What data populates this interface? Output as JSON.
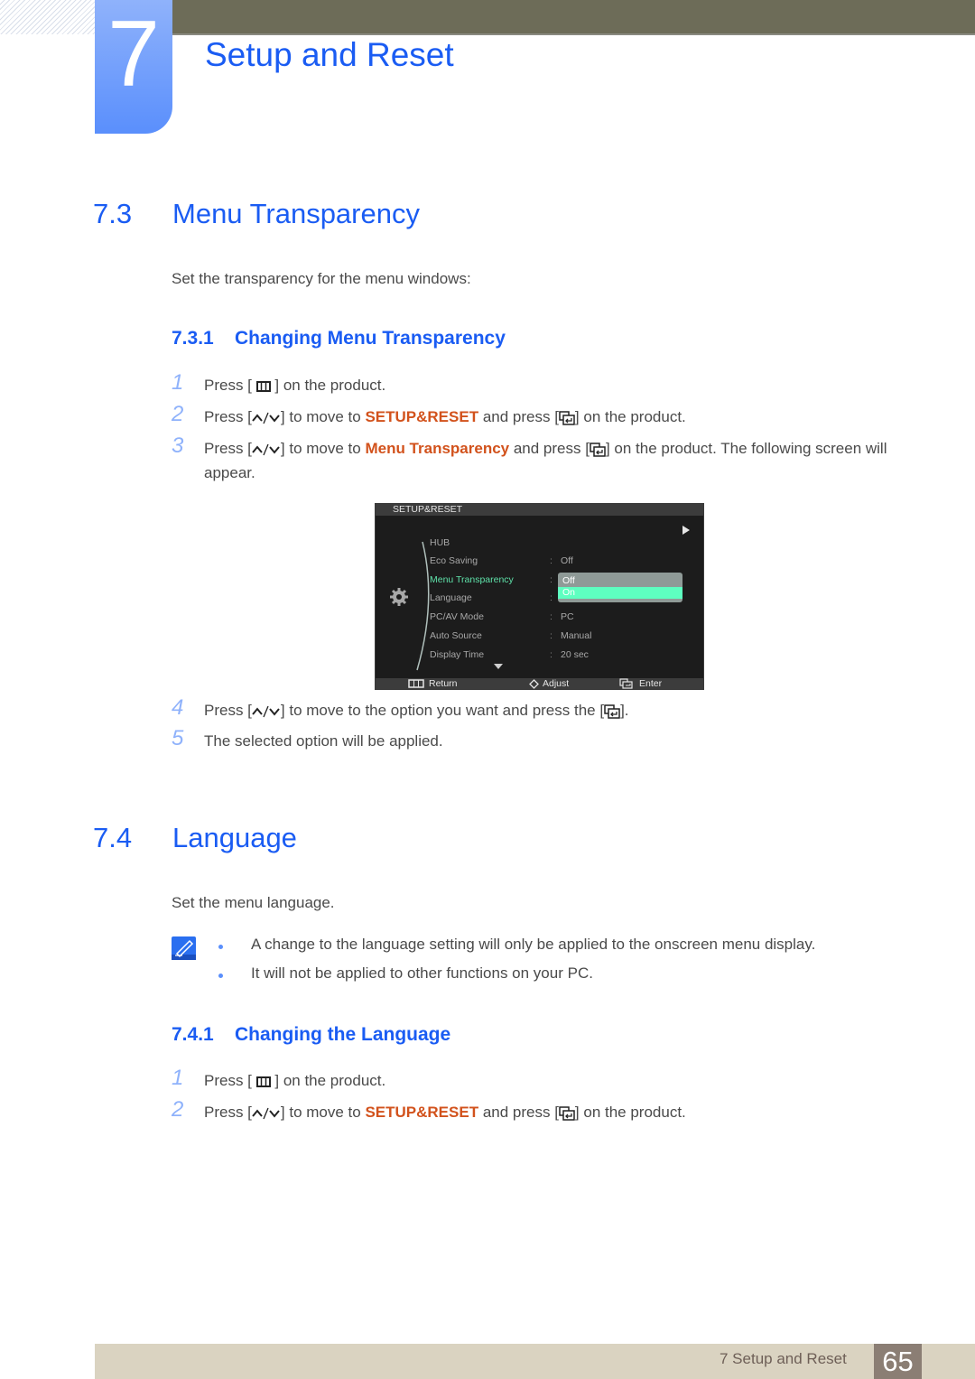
{
  "header": {
    "chapter_number": "7",
    "chapter_title": "Setup and Reset",
    "colors": {
      "accent_blue": "#1a5cf3",
      "highlight_orange": "#d2521c",
      "top_bar": "#6d6c58"
    }
  },
  "section_7_3": {
    "number": "7.3",
    "title": "Menu Transparency",
    "intro": "Set the transparency for the menu windows:",
    "subsection": {
      "number": "7.3.1",
      "title": "Changing Menu Transparency"
    },
    "steps": [
      {
        "num": "1",
        "pre": "Press [",
        "icon": "menu-button-icon",
        "post": "] on the product."
      },
      {
        "num": "2",
        "pre": "Press [",
        "icon": "up-down-arrows-icon",
        "mid": "] to move to ",
        "highlight": "SETUP&RESET",
        "mid2": " and press [",
        "icon2": "enter-source-icon",
        "post": "] on the product."
      },
      {
        "num": "3",
        "pre": "Press [",
        "icon": "up-down-arrows-icon",
        "mid": "] to move to ",
        "highlight": "Menu Transparency",
        "mid2": " and press [",
        "icon2": "enter-source-icon",
        "post": "] on the product. The following screen will appear."
      },
      {
        "num": "4",
        "pre": "Press [",
        "icon": "up-down-arrows-icon",
        "mid": "] to move to the option you want and press the [",
        "icon2": "enter-source-icon",
        "post": "]."
      },
      {
        "num": "5",
        "text": "The selected option will be applied."
      }
    ]
  },
  "osd": {
    "title": "SETUP&RESET",
    "items": [
      {
        "label": "HUB",
        "value": ""
      },
      {
        "label": "Eco Saving",
        "value": "Off"
      },
      {
        "label": "Menu Transparency",
        "value": "",
        "selected": true
      },
      {
        "label": "Language",
        "value": ""
      },
      {
        "label": "PC/AV Mode",
        "value": "PC"
      },
      {
        "label": "Auto Source",
        "value": "Manual"
      },
      {
        "label": "Display Time",
        "value": "20 sec"
      }
    ],
    "dropdown_options": [
      "Off",
      "On"
    ],
    "dropdown_active": "On",
    "footer": {
      "return_label": "Return",
      "adjust_label": "Adjust",
      "enter_label": "Enter"
    }
  },
  "section_7_4": {
    "number": "7.4",
    "title": "Language",
    "intro": "Set the menu language.",
    "notes": [
      "A change to the language setting will only be applied to the onscreen menu display.",
      "It will not be applied to other functions on your PC."
    ],
    "subsection": {
      "number": "7.4.1",
      "title": "Changing the Language"
    },
    "steps": [
      {
        "num": "1",
        "pre": "Press [",
        "post": "] on the product."
      },
      {
        "num": "2",
        "pre": "Press [",
        "mid": "] to move to ",
        "highlight": "SETUP&RESET",
        "mid2": " and press [",
        "post": "] on the product."
      }
    ]
  },
  "footer": {
    "chapter_label": "7 Setup and Reset",
    "page_number": "65"
  }
}
